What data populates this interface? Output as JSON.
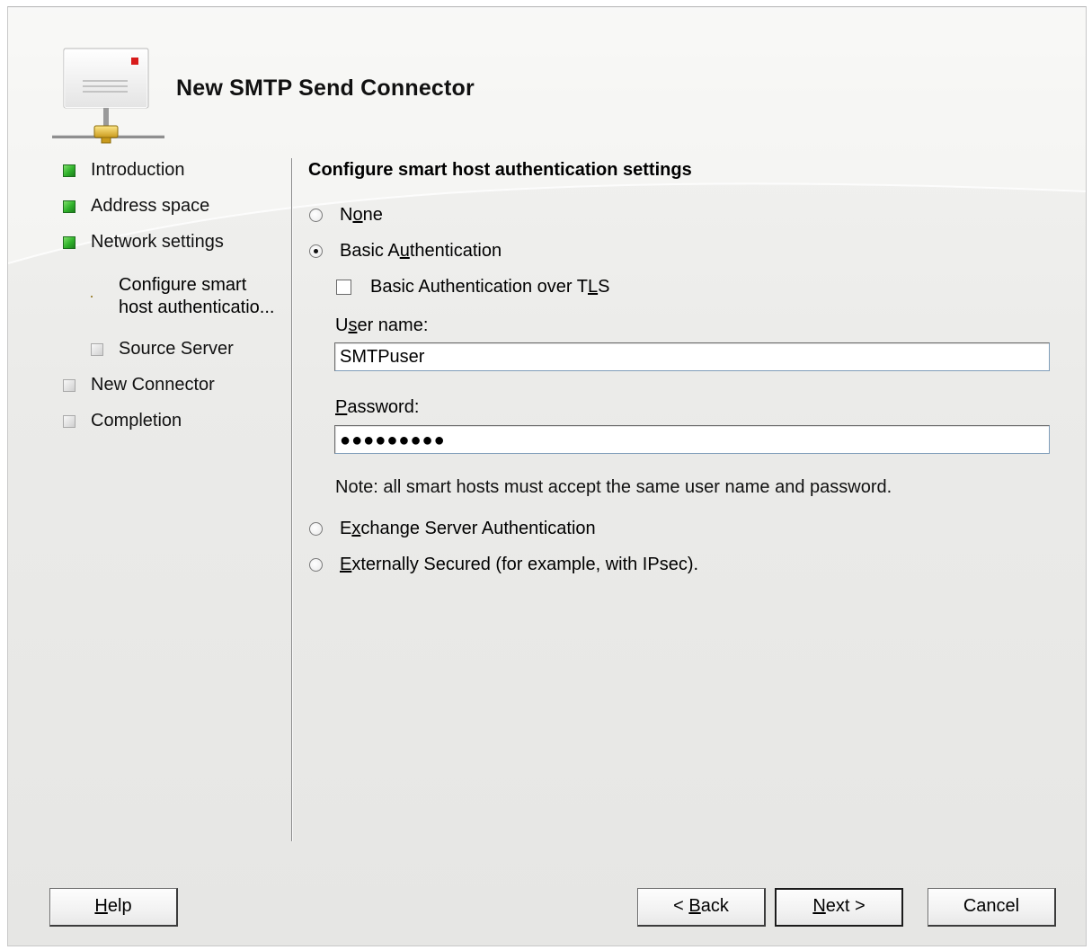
{
  "title": "New SMTP Send Connector",
  "steps": [
    {
      "label": "Introduction",
      "status": "done"
    },
    {
      "label": "Address space",
      "status": "done"
    },
    {
      "label": "Network settings",
      "status": "done"
    },
    {
      "label_line1": "Configure smart",
      "label_line2": "host authenticatio...",
      "status": "current"
    },
    {
      "label": "Source Server",
      "status": "pending"
    },
    {
      "label": "New Connector",
      "status": "pending"
    },
    {
      "label": "Completion",
      "status": "pending"
    }
  ],
  "main": {
    "heading": "Configure smart host authentication settings",
    "options": {
      "none": {
        "pre": "N",
        "key": "o",
        "post": "ne",
        "checked": false
      },
      "basic": {
        "pre": "Basic A",
        "key": "u",
        "post": "thentication",
        "checked": true
      },
      "exchange": {
        "pre": "E",
        "key": "x",
        "post": "change Server Authentication",
        "checked": false
      },
      "external": {
        "pre": "",
        "key": "E",
        "post": "xternally Secured (for example, with IPsec).",
        "checked": false
      }
    },
    "tls": {
      "pre": "Basic Authentication over T",
      "key": "L",
      "post": "S",
      "checked": false
    },
    "username": {
      "pre": "U",
      "key": "s",
      "post": "er name:",
      "value": "SMTPuser"
    },
    "password": {
      "pre": "",
      "key": "P",
      "post": "assword:",
      "value": "●●●●●●●●●"
    },
    "note": "Note: all smart hosts must accept the same user name and password."
  },
  "buttons": {
    "help": {
      "key": "H",
      "post": "elp"
    },
    "back": {
      "pre": "< ",
      "key": "B",
      "post": "ack"
    },
    "next": {
      "key": "N",
      "post": "ext >"
    },
    "cancel": "Cancel"
  },
  "colors": {
    "done": "#2fb12a",
    "current": "#f2c322",
    "pending": "#d9d9d9"
  }
}
